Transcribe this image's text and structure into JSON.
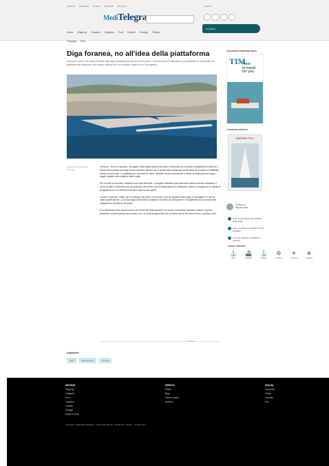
{
  "site": {
    "logo_prefix": "Medi",
    "logo_main": "Telegrap"
  },
  "topbar": [
    "Abbonati",
    "Newsletter",
    "Contatti",
    "Pubblicità",
    "Chi siamo"
  ],
  "nav": [
    "Home",
    "Shipping",
    "Trasporti",
    "Logistica",
    "Porti",
    "Cantieri",
    "Energia",
    "Politica",
    "Eventi",
    "Video"
  ],
  "subnav": [
    "Shipping",
    "Porti"
  ],
  "weather": "Genova",
  "pill_label": "Newsletter",
  "article": {
    "title": "Diga foranea, no all'idea della piattaforma",
    "subtitle": "Genova, dopo l'ok della Giunta alla diga foranea del porto di Genova, i tecnici hanno valutato la possibilità di realizzare la piattaforma offshore ma hanno deciso di non andare avanti con il progetto.",
    "caption": "Il porto di Genova (foto archivio)",
    "paragraphs": [
      "Genova – Non c'è accordo. Il progetto della diga foranea del porto di Genova non prevede la piattaforma offshore. I tecnici dell'Autorità portuale hanno valutato l'ipotesi ma la scelta resta quella già presentata nel progetto di fattibilità tecnico-economica. La piattaforma, secondo le stime, avrebbe avuto costi elevati e tempi di realizzazione troppo lunghi rispetto alle esigenze dello scalo.",
      "Più in corto la risposta, chiarisce una nota dell'ente. Il progetto definitivo sarà illustrato nelle prossime settimane e verrà avviato il confronto con gli operatori del porto e con le associazioni di categoria. Intanto proseguono le attività di progettazione e le verifiche tecniche sulla nuova opera.",
      "Il nodo è centrale, infatti, per lo sviluppo del porto di Genova e per la capacità dello scalo di accogliere le navi di ultima generazione. La nuova diga consentirà di ampliare il bacino di evoluzione e di migliorare la sicurezza della navigazione all'interno del porto.",
      "E la questione resta aperta anche sul fronte dei finanziamenti: le risorse necessarie dovranno essere reperite attraverso fondi nazionali ed europei, con un cronoprogramma che prevede l'avvio dei lavori entro i prossimi anni."
    ],
    "share_label": "Condividi"
  },
  "tags_label": "Argomenti",
  "tags": [
    "diga",
    "Diga foranea",
    "Genova"
  ],
  "sidebar": {
    "ad_head": "TELEGRAPH MARITIME NEWS",
    "ad_brand": "TIM",
    "ad_text": [
      "Fleet",
      "to travel",
      "for you"
    ],
    "mag_head": "L'EDIZIONE DIGITALE",
    "mag_title": "SHIPPING ITALY",
    "author_name": "Redazione",
    "author_role": "Shipping Italy",
    "related": [
      "Porti, al via il piano per il rilancio dello scalo",
      "Porti, concluso il confronto con gli operatori",
      "Genova, shipping e logistica in crescita"
    ],
    "icons_head": "CANALI TEMATICI",
    "icons": [
      {
        "glyph": "⚓",
        "label": "Porti"
      },
      {
        "glyph": "🚢",
        "label": "Shipping"
      },
      {
        "glyph": "⚓",
        "label": "Nautica"
      },
      {
        "glyph": "⚙",
        "label": "Cantieri"
      },
      {
        "glyph": "✈",
        "label": "Trasporti"
      },
      {
        "glyph": "⛯",
        "label": "Logistica"
      }
    ]
  },
  "footer": {
    "col1_head": "SEZIONI",
    "col1": [
      "Shipping",
      "Trasporti",
      "Porti",
      "Logistica",
      "Cantieri",
      "Energia",
      "Eventi e Fiere"
    ],
    "col2_head": "SERVIZI",
    "col2": [
      "Eventi",
      "Blog",
      "Guide al porto",
      "Archivio"
    ],
    "col3_head": "SOCIAL",
    "col3": [
      "Facebook",
      "Twitter",
      "LinkedIn",
      "Rss"
    ],
    "legal": "Copyright © 2024 Medi Telegraph – Tutti i diritti riservati – Partita IVA – Privacy – Cookie policy"
  }
}
